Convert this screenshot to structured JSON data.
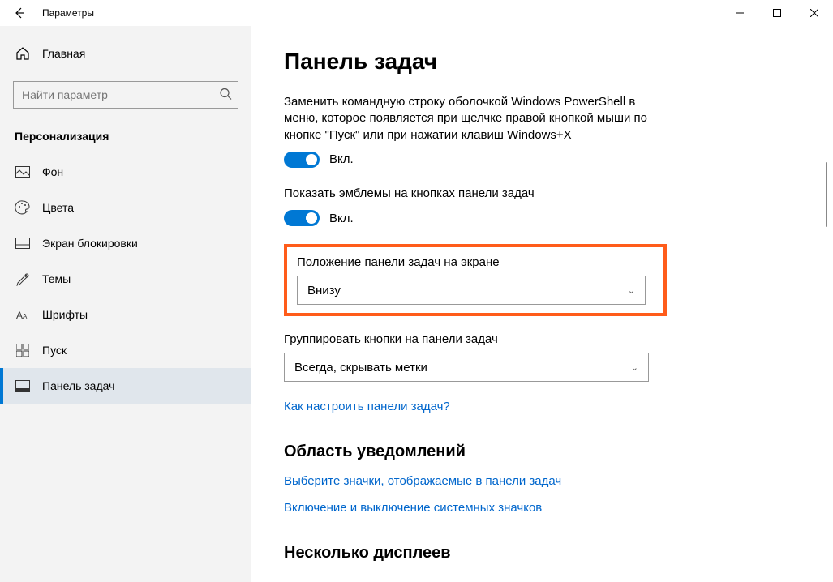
{
  "titlebar": {
    "title": "Параметры"
  },
  "sidebar": {
    "home": "Главная",
    "search_placeholder": "Найти параметр",
    "category": "Персонализация",
    "items": [
      {
        "label": "Фон"
      },
      {
        "label": "Цвета"
      },
      {
        "label": "Экран блокировки"
      },
      {
        "label": "Темы"
      },
      {
        "label": "Шрифты"
      },
      {
        "label": "Пуск"
      },
      {
        "label": "Панель задач"
      }
    ]
  },
  "page": {
    "title": "Панель задач",
    "powershell_desc": "Заменить командную строку оболочкой Windows PowerShell в меню, которое появляется при щелчке правой кнопкой мыши по кнопке \"Пуск\" или при нажатии клавиш Windows+X",
    "toggle_on": "Вкл.",
    "badges_label": "Показать эмблемы на кнопках панели задач",
    "position_label": "Положение панели задач на экране",
    "position_value": "Внизу",
    "combine_label": "Группировать кнопки на панели задач",
    "combine_value": "Всегда, скрывать метки",
    "customize_link": "Как настроить панели задач?",
    "notification_title": "Область уведомлений",
    "select_icons_link": "Выберите значки, отображаемые в панели задач",
    "system_icons_link": "Включение и выключение системных значков",
    "multi_displays_title": "Несколько дисплеев"
  }
}
